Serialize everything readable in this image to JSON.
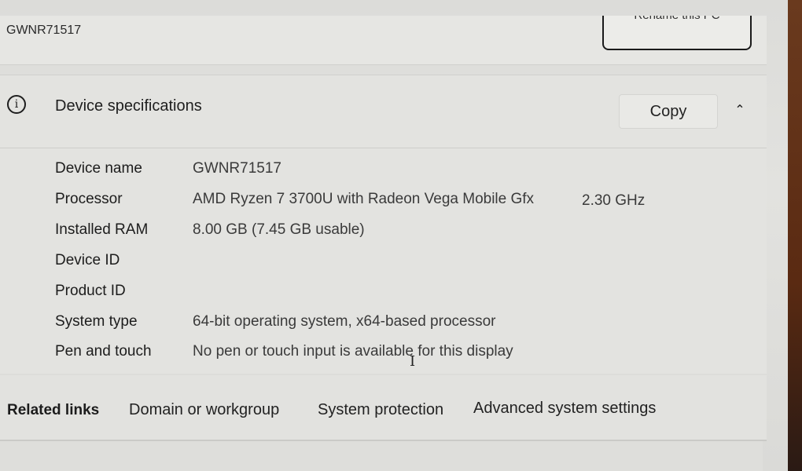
{
  "top_card": {
    "pc_name": "GWNR71517",
    "rename_button_label": "Rename this PC"
  },
  "device_specifications": {
    "icon": "info-icon",
    "title": "Device specifications",
    "copy_button_label": "Copy",
    "collapse_icon": "chevron-up-icon",
    "rows": [
      {
        "label": "Device name",
        "value": "GWNR71517",
        "extra": ""
      },
      {
        "label": "Processor",
        "value": "AMD Ryzen 7 3700U with Radeon Vega Mobile Gfx",
        "extra": "2.30 GHz"
      },
      {
        "label": "Installed RAM",
        "value": "8.00 GB (7.45 GB usable)",
        "extra": ""
      },
      {
        "label": "Device ID",
        "value": "",
        "extra": ""
      },
      {
        "label": "Product ID",
        "value": "",
        "extra": ""
      },
      {
        "label": "System type",
        "value": "64-bit operating system, x64-based processor",
        "extra": ""
      },
      {
        "label": "Pen and touch",
        "value": "No pen or touch input is available for this display",
        "extra": ""
      }
    ]
  },
  "related_links": {
    "title": "Related links",
    "links": [
      "Domain or workgroup",
      "System protection",
      "Advanced system settings"
    ]
  }
}
